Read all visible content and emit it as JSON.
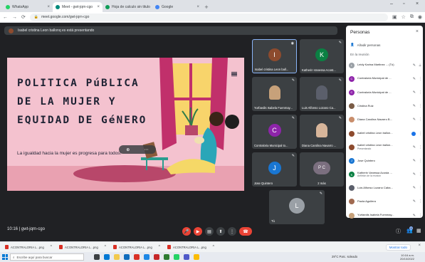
{
  "browser": {
    "tabs": [
      {
        "label": "WhatsApp",
        "color": "#25d366",
        "active": false
      },
      {
        "label": "Meet - gwt-jqrn-cgo",
        "color": "#00897b",
        "active": true
      },
      {
        "label": "Hoja de calculo sin titulo",
        "color": "#0f9d58",
        "active": false
      },
      {
        "label": "Google",
        "color": "#4285f4",
        "active": false
      }
    ],
    "url": "meet.google.com/gwt-jqrn-cgo"
  },
  "meet": {
    "presenting_banner": "Isabel cristina Leon ballonq es está presentando",
    "time": "10:16",
    "separator": "|",
    "meeting_code": "gwt-jqrn-cgo"
  },
  "slide": {
    "title": "POLITICA PúBLICA\nDE LA MUJER Y\nEQUIDAD DE GéNERO",
    "subtitle": "La igualdad hacia la mujer es progresa para todos!",
    "colors": {
      "background": "#f4c2cf",
      "wall": "#f2a7b9",
      "curtain": "#c1306b",
      "floor": "#e9a1b1",
      "rug": "#b8476a",
      "text": "#1e2233"
    }
  },
  "tiles": [
    {
      "name": "Isabel cristina Leon ball...",
      "initial": "I",
      "avatar_color": "#8d4b2e",
      "type": "letter",
      "speaking": true
    },
    {
      "name": "Katherin Vanessa Acost...",
      "initial": "K",
      "avatar_color": "#0b8043",
      "type": "letter",
      "speaking": false
    },
    {
      "name": "Yurfaedis Isabela Fuenmay...",
      "initial": "",
      "avatar_color": "#c7a17a",
      "type": "photo",
      "speaking": false
    },
    {
      "name": "Luis Alfonso Lozano Ca...",
      "initial": "",
      "avatar_color": "#5b5f6b",
      "type": "photo",
      "speaking": false
    },
    {
      "name": "Contraloria Municipal to...",
      "initial": "C",
      "avatar_color": "#8e24aa",
      "type": "letter",
      "speaking": false
    },
    {
      "name": "Diana Carolina Navarro ...",
      "initial": "",
      "avatar_color": "#d7b59a",
      "type": "photo",
      "speaking": false
    },
    {
      "name": "Jose Quintero",
      "initial": "J",
      "avatar_color": "#1976d2",
      "type": "letter",
      "speaking": false
    },
    {
      "name": "2 más",
      "initial": "P C",
      "avatar_color": "#7b6f7f",
      "type": "group",
      "speaking": false
    },
    {
      "name": "Tú",
      "initial": "L",
      "avatar_color": "#9aa0a6",
      "type": "letter",
      "speaking": false
    }
  ],
  "panel": {
    "title": "Personas",
    "close": "×",
    "add_people": "Añadir personas",
    "section": "En la reunión",
    "people": [
      {
        "name": "Leidy Karina Martinez ... (Tú)",
        "sub": "",
        "initial": "L",
        "color": "#9aa0a6"
      },
      {
        "name": "Contraloria Municipal de ...",
        "sub": "",
        "initial": "C",
        "color": "#8e24aa"
      },
      {
        "name": "Contraloria Municipal de ...",
        "sub": "",
        "initial": "C",
        "color": "#8e24aa"
      },
      {
        "name": "Cristina Ruiz",
        "sub": "",
        "initial": "",
        "color": "#7a5c46"
      },
      {
        "name": "Diana Carolina Navarro B...",
        "sub": "",
        "initial": "",
        "color": "#c98e6c"
      },
      {
        "name": "Isabel cristina Leon ballon...",
        "sub": "",
        "initial": "",
        "color": "#8d4b2e"
      },
      {
        "name": "Isabel cristina Leon ballon...",
        "sub": "Presentando",
        "initial": "",
        "color": "#8d4b2e"
      },
      {
        "name": "Jose Quintero",
        "sub": "",
        "initial": "J",
        "color": "#1976d2"
      },
      {
        "name": "Katherin Vanessa Acosta ...",
        "sub": "Anfitrión de la reunión",
        "initial": "K",
        "color": "#0b8043"
      },
      {
        "name": "Luis Alfonso Lozano Caba...",
        "sub": "",
        "initial": "",
        "color": "#5b5f6b"
      },
      {
        "name": "Paola Aguilera",
        "sub": "",
        "initial": "",
        "color": "#a06a50"
      },
      {
        "name": "Yurfaedis Isabela Fuenmay...",
        "sub": "",
        "initial": "",
        "color": "#c7a17a"
      }
    ]
  },
  "downloads": {
    "items": [
      "ACONTRALORIA L...png",
      "ACONTRALORIA L...png",
      "ACONTRALORIA L...png",
      "ACONTRALORIA L...png"
    ],
    "show_all": "Mostrar todo"
  },
  "taskbar": {
    "search_placeholder": "Escribe aquí para buscar",
    "weather": "29°C Parc. soleado",
    "time": "10:16 a.m.",
    "date": "20/10/2022"
  },
  "people_count": "9"
}
